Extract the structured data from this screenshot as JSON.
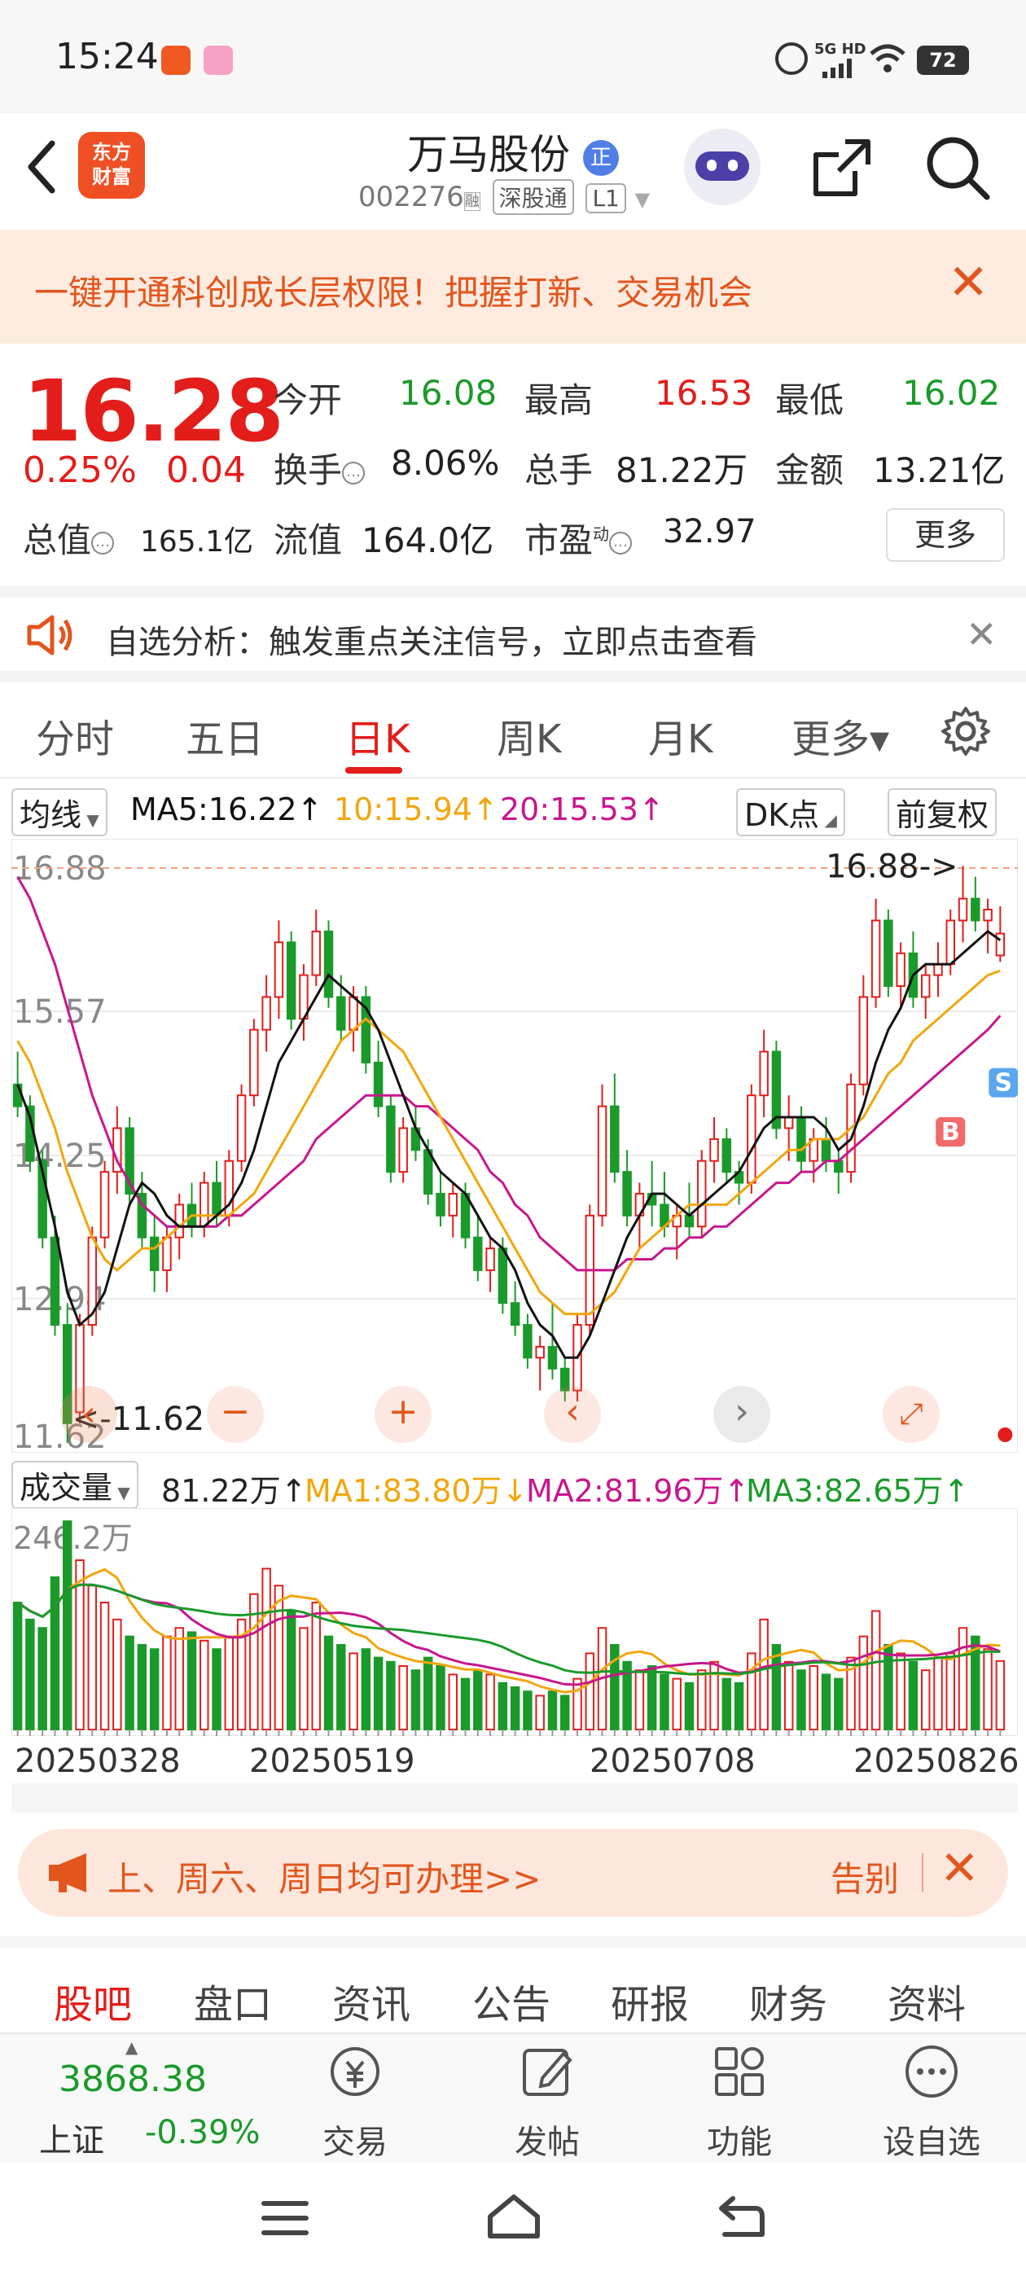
{
  "status": {
    "time": "15:24",
    "battery": "72",
    "network": "5G HD"
  },
  "header": {
    "title": "万马股份",
    "badge": "正",
    "code": "002276",
    "code_suffix": "融",
    "market": "深股通",
    "level": "L1",
    "logo_line1": "东方",
    "logo_line2": "财富"
  },
  "banner": {
    "text": "一键开通科创成长层权限！把握打新、交易机会"
  },
  "quote": {
    "price": "16.28",
    "change_pct": "0.25%",
    "change": "0.04",
    "open_label": "今开",
    "open": "16.08",
    "high_label": "最高",
    "high": "16.53",
    "low_label": "最低",
    "low": "16.02",
    "turnover_label": "换手",
    "turnover": "8.06%",
    "volume_label": "总手",
    "volume": "81.22万",
    "amount_label": "金额",
    "amount": "13.21亿",
    "mktcap_label": "总值",
    "mktcap": "165.1亿",
    "float_label": "流值",
    "float": "164.0亿",
    "pe_label": "市盈",
    "pe_sup": "动",
    "pe": "32.97",
    "more": "更多"
  },
  "analysis": {
    "text": "自选分析：触发重点关注信号，立即点击查看"
  },
  "tabs": [
    "分时",
    "五日",
    "日K",
    "周K",
    "月K",
    "更多▾"
  ],
  "active_tab": "日K",
  "ma": {
    "selector": "均线",
    "ma5": "MA5:16.22↑",
    "ma10": "10:15.94↑",
    "ma20": "20:15.53↑",
    "dk": "DK点",
    "adjust": "前复权"
  },
  "colors": {
    "up": "#e31d1a",
    "down": "#1a9a2a",
    "ma5": "#111111",
    "ma10": "#f2a60c",
    "ma20": "#c8168d",
    "accent": "#e2551c"
  },
  "chart_data": {
    "type": "candlestick",
    "y_ticks": [
      "16.88",
      "15.57",
      "14.25",
      "12.94",
      "11.62"
    ],
    "ylim": [
      11.62,
      16.88
    ],
    "max_marker": "16.88->",
    "min_marker": "<-11.62",
    "markers": [
      "B",
      "S"
    ],
    "ohlc": [
      [
        14.9,
        15.2,
        14.6,
        14.7
      ],
      [
        14.7,
        14.8,
        14.1,
        14.2
      ],
      [
        14.2,
        14.3,
        13.4,
        13.5
      ],
      [
        13.5,
        13.7,
        12.6,
        12.7
      ],
      [
        12.7,
        12.9,
        11.62,
        11.8
      ],
      [
        11.9,
        12.8,
        11.8,
        12.7
      ],
      [
        12.7,
        13.6,
        12.6,
        13.5
      ],
      [
        13.5,
        14.2,
        13.4,
        14.1
      ],
      [
        14.1,
        14.7,
        13.9,
        14.5
      ],
      [
        14.5,
        14.6,
        13.8,
        13.9
      ],
      [
        13.9,
        14.1,
        13.4,
        13.5
      ],
      [
        13.5,
        13.7,
        13.0,
        13.2
      ],
      [
        13.2,
        13.6,
        13.0,
        13.5
      ],
      [
        13.5,
        13.9,
        13.3,
        13.8
      ],
      [
        13.8,
        14.0,
        13.5,
        13.6
      ],
      [
        13.6,
        14.1,
        13.5,
        14.0
      ],
      [
        14.0,
        14.2,
        13.6,
        13.7
      ],
      [
        13.7,
        14.3,
        13.6,
        14.2
      ],
      [
        14.2,
        14.9,
        14.1,
        14.8
      ],
      [
        14.8,
        15.5,
        14.7,
        15.4
      ],
      [
        15.4,
        15.9,
        15.2,
        15.7
      ],
      [
        15.7,
        16.4,
        15.5,
        16.2
      ],
      [
        16.2,
        16.3,
        15.4,
        15.5
      ],
      [
        15.5,
        16.0,
        15.3,
        15.9
      ],
      [
        15.9,
        16.5,
        15.8,
        16.3
      ],
      [
        16.3,
        16.4,
        15.6,
        15.7
      ],
      [
        15.7,
        15.9,
        15.3,
        15.4
      ],
      [
        15.4,
        15.8,
        15.2,
        15.7
      ],
      [
        15.7,
        15.8,
        15.0,
        15.1
      ],
      [
        15.1,
        15.3,
        14.6,
        14.7
      ],
      [
        14.7,
        14.8,
        14.0,
        14.1
      ],
      [
        14.1,
        14.6,
        14.0,
        14.5
      ],
      [
        14.5,
        14.7,
        14.2,
        14.3
      ],
      [
        14.3,
        14.4,
        13.8,
        13.9
      ],
      [
        13.9,
        14.1,
        13.6,
        13.7
      ],
      [
        13.7,
        14.0,
        13.5,
        13.9
      ],
      [
        13.9,
        14.0,
        13.4,
        13.5
      ],
      [
        13.5,
        13.7,
        13.1,
        13.2
      ],
      [
        13.2,
        13.5,
        13.0,
        13.4
      ],
      [
        13.4,
        13.5,
        12.8,
        12.9
      ],
      [
        12.9,
        13.1,
        12.6,
        12.7
      ],
      [
        12.7,
        12.8,
        12.3,
        12.4
      ],
      [
        12.4,
        12.6,
        12.1,
        12.5
      ],
      [
        12.5,
        12.9,
        12.2,
        12.3
      ],
      [
        12.3,
        12.4,
        12.0,
        12.1
      ],
      [
        12.1,
        12.8,
        12.0,
        12.7
      ],
      [
        12.7,
        13.8,
        12.6,
        13.7
      ],
      [
        13.7,
        14.9,
        13.6,
        14.7
      ],
      [
        14.7,
        15.0,
        14.0,
        14.1
      ],
      [
        14.1,
        14.3,
        13.6,
        13.7
      ],
      [
        13.7,
        14.0,
        13.4,
        13.9
      ],
      [
        13.9,
        14.2,
        13.6,
        13.8
      ],
      [
        13.8,
        14.1,
        13.5,
        13.6
      ],
      [
        13.6,
        13.8,
        13.3,
        13.7
      ],
      [
        13.7,
        14.0,
        13.5,
        13.6
      ],
      [
        13.6,
        14.3,
        13.5,
        14.2
      ],
      [
        14.2,
        14.6,
        14.0,
        14.4
      ],
      [
        14.4,
        14.5,
        14.0,
        14.1
      ],
      [
        14.1,
        14.2,
        13.8,
        14.0
      ],
      [
        14.0,
        14.9,
        13.9,
        14.8
      ],
      [
        14.8,
        15.4,
        14.6,
        15.2
      ],
      [
        15.2,
        15.3,
        14.4,
        14.5
      ],
      [
        14.5,
        14.8,
        14.2,
        14.6
      ],
      [
        14.6,
        14.7,
        14.1,
        14.2
      ],
      [
        14.2,
        14.5,
        14.0,
        14.4
      ],
      [
        14.4,
        14.6,
        14.1,
        14.2
      ],
      [
        14.2,
        14.3,
        13.9,
        14.1
      ],
      [
        14.1,
        15.0,
        14.0,
        14.9
      ],
      [
        14.9,
        15.9,
        14.8,
        15.7
      ],
      [
        15.7,
        16.6,
        15.6,
        16.4
      ],
      [
        16.4,
        16.5,
        15.7,
        15.8
      ],
      [
        15.8,
        16.2,
        15.6,
        16.1
      ],
      [
        16.1,
        16.3,
        15.6,
        15.7
      ],
      [
        15.7,
        16.0,
        15.5,
        15.9
      ],
      [
        15.9,
        16.2,
        15.7,
        16.0
      ],
      [
        16.0,
        16.5,
        15.9,
        16.4
      ],
      [
        16.4,
        16.9,
        16.2,
        16.6
      ],
      [
        16.6,
        16.8,
        16.3,
        16.4
      ],
      [
        16.4,
        16.6,
        16.1,
        16.5
      ],
      [
        16.08,
        16.53,
        16.02,
        16.28
      ]
    ],
    "ma5": [
      14.9,
      14.6,
      14.1,
      13.6,
      13.0,
      12.7,
      12.8,
      13.0,
      13.4,
      13.8,
      14.0,
      13.9,
      13.7,
      13.6,
      13.6,
      13.6,
      13.7,
      13.8,
      14.0,
      14.3,
      14.7,
      15.1,
      15.3,
      15.5,
      15.7,
      15.9,
      15.8,
      15.7,
      15.6,
      15.4,
      15.1,
      14.8,
      14.5,
      14.3,
      14.1,
      14.0,
      13.9,
      13.7,
      13.5,
      13.4,
      13.2,
      12.9,
      12.7,
      12.6,
      12.4,
      12.4,
      12.6,
      12.9,
      13.2,
      13.5,
      13.7,
      13.9,
      13.9,
      13.8,
      13.7,
      13.8,
      13.9,
      14.0,
      14.1,
      14.3,
      14.5,
      14.6,
      14.6,
      14.6,
      14.6,
      14.5,
      14.3,
      14.4,
      14.7,
      15.1,
      15.4,
      15.6,
      15.9,
      16.0,
      16.0,
      16.0,
      16.1,
      16.2,
      16.3,
      16.22
    ],
    "ma10": [
      15.3,
      15.1,
      14.8,
      14.5,
      14.1,
      13.8,
      13.5,
      13.3,
      13.2,
      13.3,
      13.4,
      13.4,
      13.5,
      13.6,
      13.7,
      13.7,
      13.7,
      13.7,
      13.8,
      13.9,
      14.1,
      14.3,
      14.5,
      14.7,
      14.9,
      15.1,
      15.3,
      15.4,
      15.5,
      15.4,
      15.3,
      15.2,
      15.0,
      14.8,
      14.6,
      14.4,
      14.2,
      14.0,
      13.8,
      13.6,
      13.4,
      13.2,
      13.0,
      12.9,
      12.8,
      12.8,
      12.8,
      12.9,
      13.0,
      13.2,
      13.4,
      13.5,
      13.6,
      13.7,
      13.8,
      13.8,
      13.8,
      13.8,
      13.9,
      14.0,
      14.1,
      14.2,
      14.3,
      14.3,
      14.4,
      14.4,
      14.4,
      14.5,
      14.6,
      14.8,
      15.0,
      15.1,
      15.3,
      15.4,
      15.5,
      15.6,
      15.7,
      15.8,
      15.9,
      15.94
    ],
    "ma20": [
      16.8,
      16.6,
      16.3,
      16.0,
      15.6,
      15.2,
      14.8,
      14.5,
      14.2,
      14.0,
      13.8,
      13.7,
      13.6,
      13.6,
      13.6,
      13.6,
      13.6,
      13.7,
      13.7,
      13.8,
      13.9,
      14.0,
      14.1,
      14.2,
      14.4,
      14.5,
      14.6,
      14.7,
      14.8,
      14.8,
      14.8,
      14.8,
      14.7,
      14.7,
      14.6,
      14.5,
      14.4,
      14.3,
      14.1,
      14.0,
      13.8,
      13.7,
      13.5,
      13.4,
      13.3,
      13.2,
      13.2,
      13.2,
      13.2,
      13.3,
      13.3,
      13.3,
      13.4,
      13.4,
      13.5,
      13.5,
      13.6,
      13.6,
      13.7,
      13.8,
      13.9,
      14.0,
      14.0,
      14.1,
      14.1,
      14.2,
      14.2,
      14.3,
      14.4,
      14.5,
      14.6,
      14.7,
      14.8,
      14.9,
      15.0,
      15.1,
      15.2,
      15.3,
      15.4,
      15.53
    ],
    "volume_label": "成交量",
    "volume_now": "81.22万↑",
    "vol_ma1": "MA1:83.80万↓",
    "vol_ma2": "MA2:81.96万↑",
    "vol_ma3": "MA3:82.65万↑",
    "vol_max_label": "246.2万",
    "vol_max": 246.2,
    "volume": [
      150,
      130,
      120,
      180,
      246,
      200,
      170,
      150,
      130,
      110,
      100,
      95,
      110,
      120,
      115,
      105,
      95,
      110,
      130,
      160,
      190,
      170,
      140,
      120,
      150,
      110,
      100,
      90,
      95,
      85,
      80,
      75,
      70,
      85,
      75,
      65,
      60,
      70,
      65,
      55,
      50,
      45,
      40,
      45,
      40,
      60,
      90,
      120,
      100,
      80,
      70,
      75,
      65,
      60,
      55,
      70,
      80,
      60,
      55,
      90,
      130,
      100,
      80,
      70,
      75,
      65,
      60,
      85,
      110,
      140,
      100,
      90,
      80,
      70,
      85,
      90,
      120,
      110,
      95,
      81
    ],
    "x_tick_labels": [
      "20250328",
      "20250519",
      "20250708",
      "20250826"
    ]
  },
  "promo": {
    "text": "上、周六、周日均可办理>>",
    "dismiss": "告别"
  },
  "bottom_tabs": [
    "股吧",
    "盘口",
    "资讯",
    "公告",
    "研报",
    "财务",
    "资料"
  ],
  "active_bottom_tab": "股吧",
  "index": {
    "value": "3868.38",
    "name": "上证",
    "change": "-0.39%"
  },
  "nav": {
    "trade": "交易",
    "post": "发帖",
    "features": "功能",
    "add_watch": "设自选"
  }
}
